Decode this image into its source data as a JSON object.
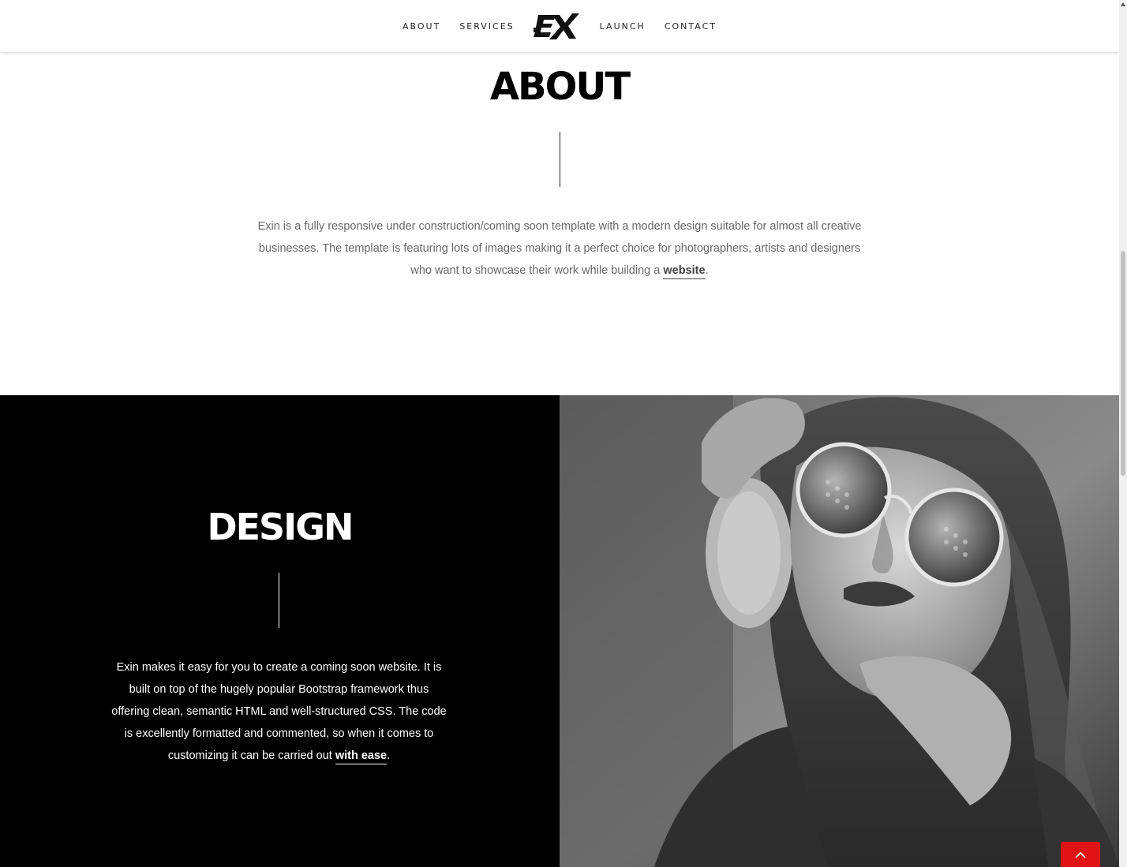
{
  "nav": {
    "items": [
      {
        "label": "ABOUT"
      },
      {
        "label": "SERVICES"
      },
      {
        "label": "LAUNCH"
      },
      {
        "label": "CONTACT"
      }
    ]
  },
  "about": {
    "title": "ABOUT",
    "text_before": "Exin is a fully responsive under construction/coming soon template with a modern design suitable for almost all creative businesses. The template is featuring lots of images making it a perfect choice for photographers, artists and designers who want to showcase their work while building a ",
    "link": "website",
    "text_after": "."
  },
  "design": {
    "title": "DESIGN",
    "text_before": "Exin makes it easy for you to create a coming soon website. It is built on top of the hugely popular Bootstrap framework thus offering clean, semantic HTML and well-structured CSS. The code is excellently formatted and commented, so when it comes to customizing it can be carried out ",
    "link": "with ease",
    "text_after": "."
  },
  "colors": {
    "accent": "#e01414",
    "dark": "#000000",
    "text_muted": "#666666"
  },
  "icons": {
    "logo": "ex-logo",
    "scroll_top": "chevron-up-icon"
  }
}
